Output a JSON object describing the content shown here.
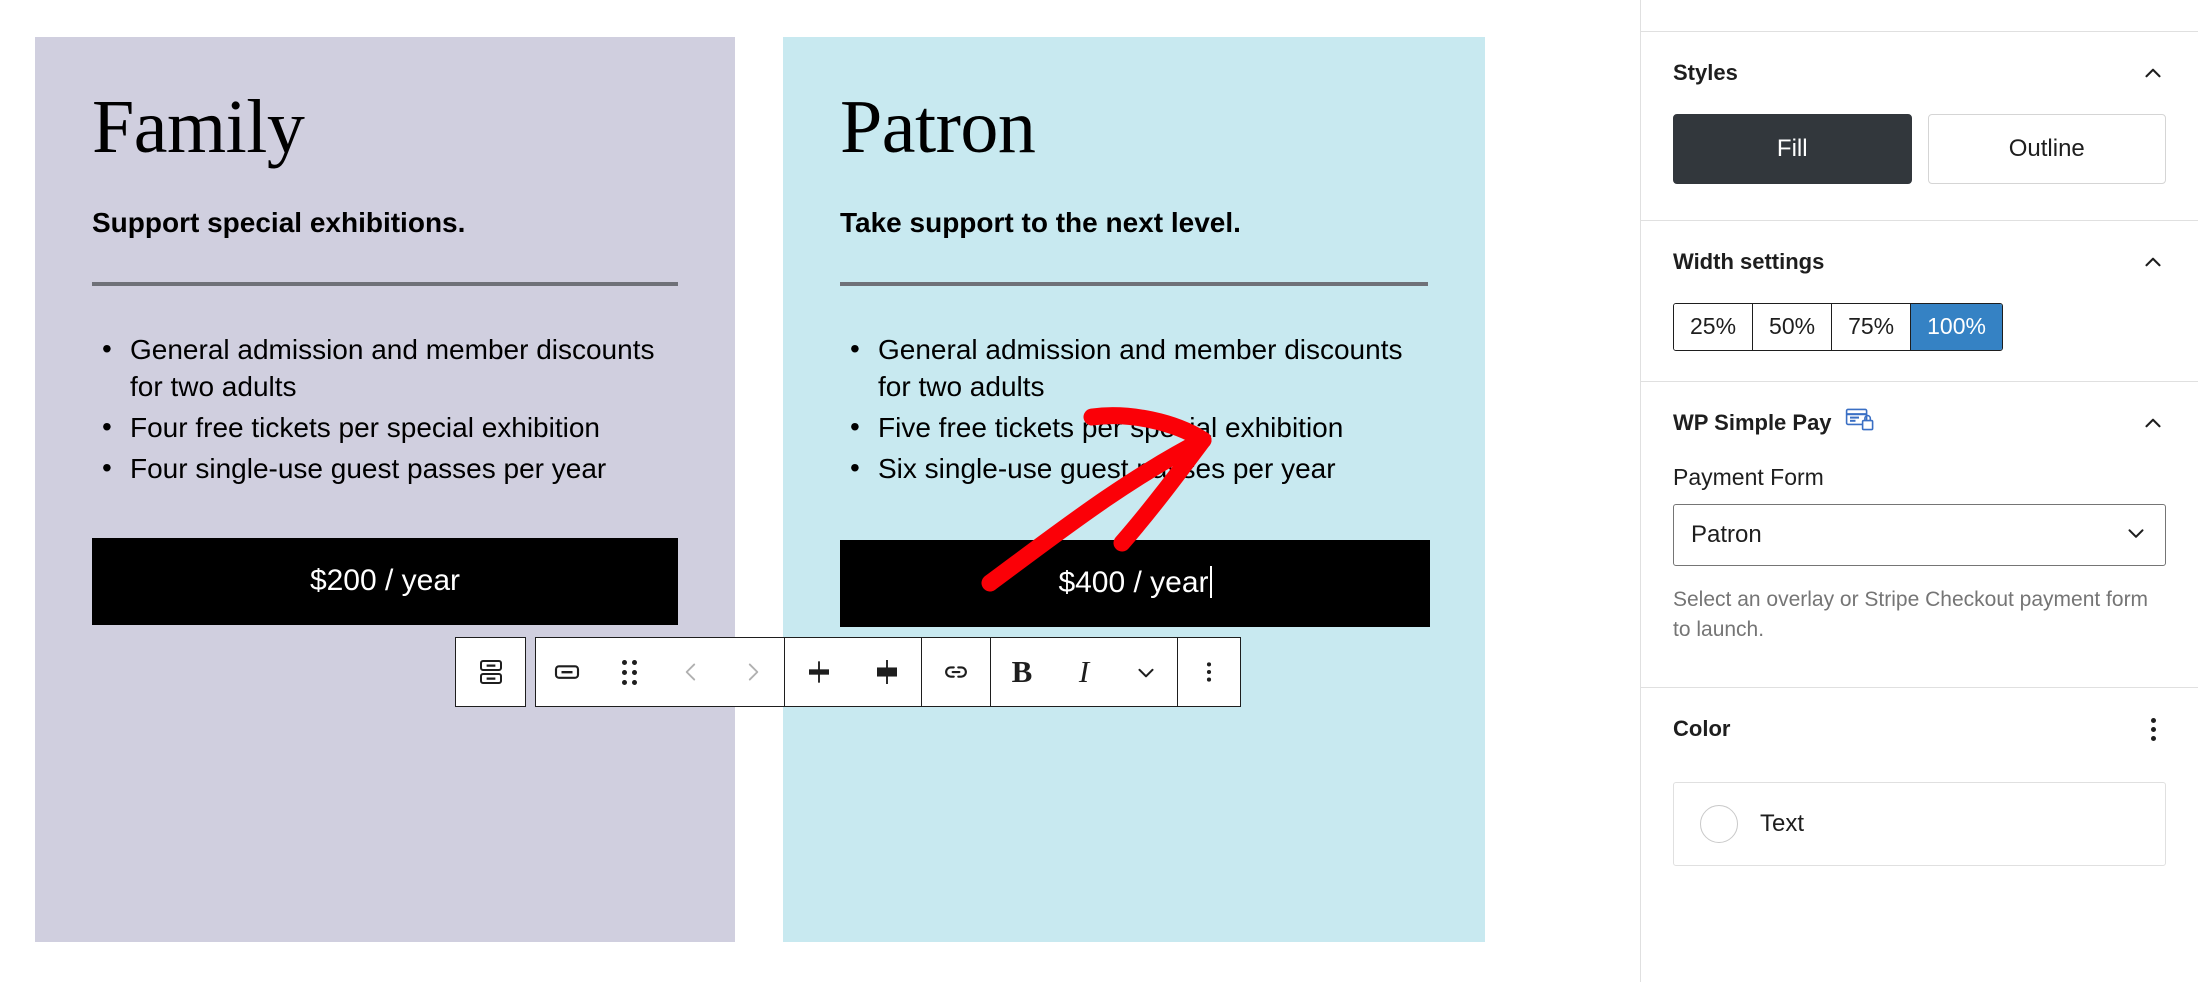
{
  "canvas": {
    "cards": [
      {
        "name": "Family",
        "title": "Family",
        "subtitle": "Support special exhibitions.",
        "bg_color": "#d0cfdf",
        "features": [
          "General admission and member discounts for two adults",
          "Four free tickets per special exhibition",
          "Four single-use guest passes per year"
        ],
        "price_label": "$200 / year"
      },
      {
        "name": "Patron",
        "title": "Patron",
        "subtitle": "Take support to the next level.",
        "bg_color": "#c8e9f0",
        "features": [
          "General admission and member discounts for two adults",
          "Five free tickets per special exhibition",
          "Six single-use guest passes per year"
        ],
        "price_label": "$400 / year"
      }
    ]
  },
  "toolbars": {
    "parent_block": {
      "icon": "select-parent-block-icon",
      "label": "Select Buttons"
    },
    "main": {
      "groups": [
        {
          "buttons": [
            {
              "icon": "button-block-icon",
              "label": "Button",
              "interactable": true
            },
            {
              "icon": "drag-handle-icon",
              "label": "Drag",
              "interactable": true
            },
            {
              "icon": "chevron-left-icon",
              "label": "Move left",
              "interactable": false
            },
            {
              "icon": "chevron-right-icon",
              "label": "Move right",
              "interactable": false
            }
          ]
        },
        {
          "buttons": [
            {
              "icon": "align-text-center-icon",
              "label": "Align text",
              "interactable": true
            },
            {
              "icon": "align-block-icon",
              "label": "Align",
              "interactable": true
            }
          ]
        },
        {
          "buttons": [
            {
              "icon": "link-icon",
              "label": "Link",
              "interactable": true
            }
          ]
        },
        {
          "buttons": [
            {
              "icon": "bold-icon",
              "label": "B",
              "interactable": true
            },
            {
              "icon": "italic-icon",
              "label": "I",
              "interactable": true
            },
            {
              "icon": "chevron-down-icon",
              "label": "More rich text controls",
              "interactable": true
            }
          ]
        },
        {
          "buttons": [
            {
              "icon": "more-options-icon",
              "label": "Options",
              "interactable": true
            }
          ]
        }
      ]
    }
  },
  "annotation": {
    "type": "red-arrow",
    "color": "#fb0007",
    "points_to": "payment-form-select"
  },
  "sidebar": {
    "panels": [
      {
        "id": "styles",
        "title": "Styles",
        "collapse_icon": "chevron-up-icon",
        "options": [
          {
            "label": "Fill",
            "selected": true
          },
          {
            "label": "Outline",
            "selected": false
          }
        ]
      },
      {
        "id": "width-settings",
        "title": "Width settings",
        "collapse_icon": "chevron-up-icon",
        "options": [
          {
            "label": "25%",
            "selected": false
          },
          {
            "label": "50%",
            "selected": false
          },
          {
            "label": "75%",
            "selected": false
          },
          {
            "label": "100%",
            "selected": true
          }
        ],
        "selected_color": "#3582c4"
      },
      {
        "id": "wp-simple-pay",
        "title": "WP Simple Pay",
        "title_icon": "wp-simple-pay-card-lock-icon",
        "title_icon_color": "#3a6fc4",
        "collapse_icon": "chevron-up-icon",
        "field_label": "Payment Form",
        "field_value": "Patron",
        "field_chevron": "chevron-down-icon",
        "help_text": "Select an overlay or Stripe Checkout payment form to launch."
      },
      {
        "id": "color",
        "title": "Color",
        "menu_icon": "kebab-menu-icon",
        "items": [
          {
            "label": "Text",
            "swatch": "#ffffff"
          }
        ]
      }
    ]
  }
}
